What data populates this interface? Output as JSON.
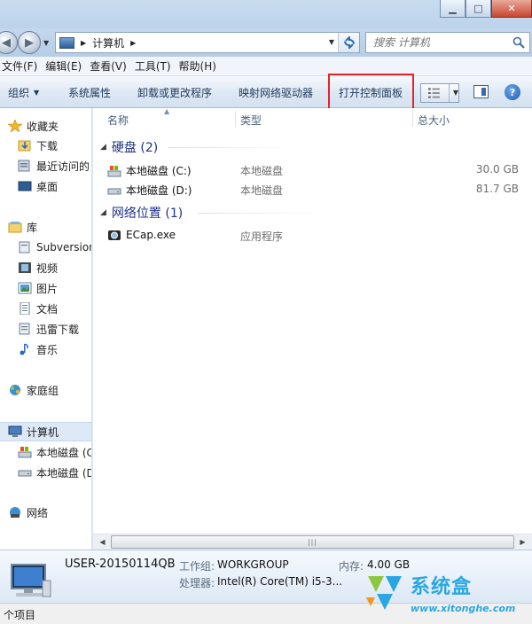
{
  "address": {
    "crumb": "计算机"
  },
  "search": {
    "placeholder": "搜索 计算机"
  },
  "menu": [
    "文件(F)",
    "编辑(E)",
    "查看(V)",
    "工具(T)",
    "帮助(H)"
  ],
  "toolbar": {
    "organize": "组织",
    "system_properties": "系统属性",
    "uninstall": "卸载或更改程序",
    "map_drive": "映射网络驱动器",
    "control_panel": "打开控制面板"
  },
  "nav": {
    "favorites": "收藏夹",
    "downloads": "下载",
    "recent": "最近访问的",
    "desktop": "桌面",
    "libraries": "库",
    "subversion": "Subversion",
    "videos": "视频",
    "pictures": "图片",
    "documents": "文档",
    "xunlei": "迅雷下载",
    "music": "音乐",
    "homegroup": "家庭组",
    "computer": "计算机",
    "disk_c": "本地磁盘 (C",
    "disk_d": "本地磁盘 (D",
    "network": "网络"
  },
  "columns": {
    "name": "名称",
    "type": "类型",
    "size": "总大小"
  },
  "groups": {
    "disks": "硬盘 (2)",
    "network": "网络位置 (1)"
  },
  "rows": {
    "disk_c": {
      "name": "本地磁盘 (C:)",
      "type": "本地磁盘",
      "size": "30.0 GB"
    },
    "disk_d": {
      "name": "本地磁盘 (D:)",
      "type": "本地磁盘",
      "size": "81.7 GB"
    },
    "ecap": {
      "name": "ECap.exe",
      "type": "应用程序"
    }
  },
  "details": {
    "computer_name": "USER-20150114QB",
    "workgroup_label": "工作组:",
    "workgroup": "WORKGROUP",
    "memory_label": "内存:",
    "memory": "4.00 GB",
    "cpu_label": "处理器:",
    "cpu": "Intel(R) Core(TM) i5-3..."
  },
  "status": "个项目",
  "logo": {
    "text": "系统盒",
    "url": "www.xitonghe.com"
  },
  "colors": {
    "highlight": "#e0262c",
    "group_header": "#1e3287",
    "logo": "#2aa7e0"
  }
}
